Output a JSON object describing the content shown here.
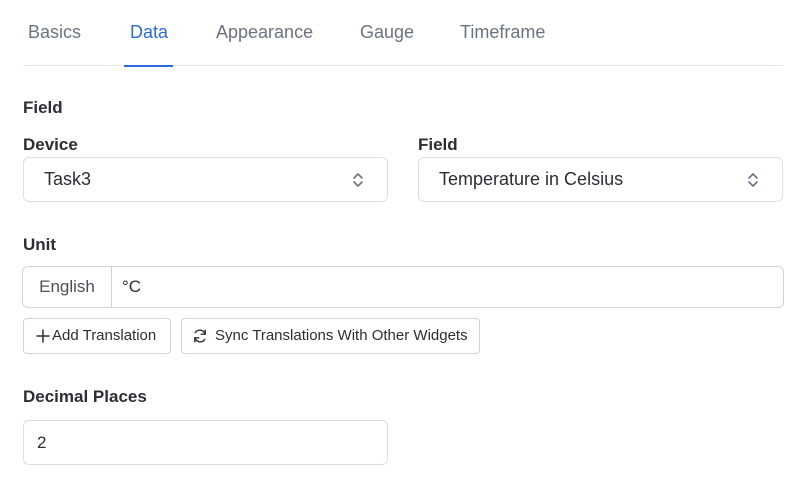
{
  "tabs": [
    {
      "label": "Basics",
      "active": false
    },
    {
      "label": "Data",
      "active": true
    },
    {
      "label": "Appearance",
      "active": false
    },
    {
      "label": "Gauge",
      "active": false
    },
    {
      "label": "Timeframe",
      "active": false
    }
  ],
  "field_section": {
    "title": "Field",
    "device": {
      "label": "Device",
      "value": "Task3"
    },
    "field": {
      "label": "Field",
      "value": "Temperature in Celsius"
    }
  },
  "unit_section": {
    "title": "Unit",
    "language": "English",
    "value": "°C",
    "add_translation_label": "Add Translation",
    "sync_label": "Sync Translations With Other Widgets"
  },
  "decimal_section": {
    "title": "Decimal Places",
    "value": "2"
  },
  "colors": {
    "accent": "#2c6bdb",
    "tab_inactive": "#6b7280",
    "border": "#dcdfe4"
  },
  "icons": {
    "select_indicator": "chevron-up-down-icon",
    "add": "plus-icon",
    "sync": "sync-icon"
  }
}
